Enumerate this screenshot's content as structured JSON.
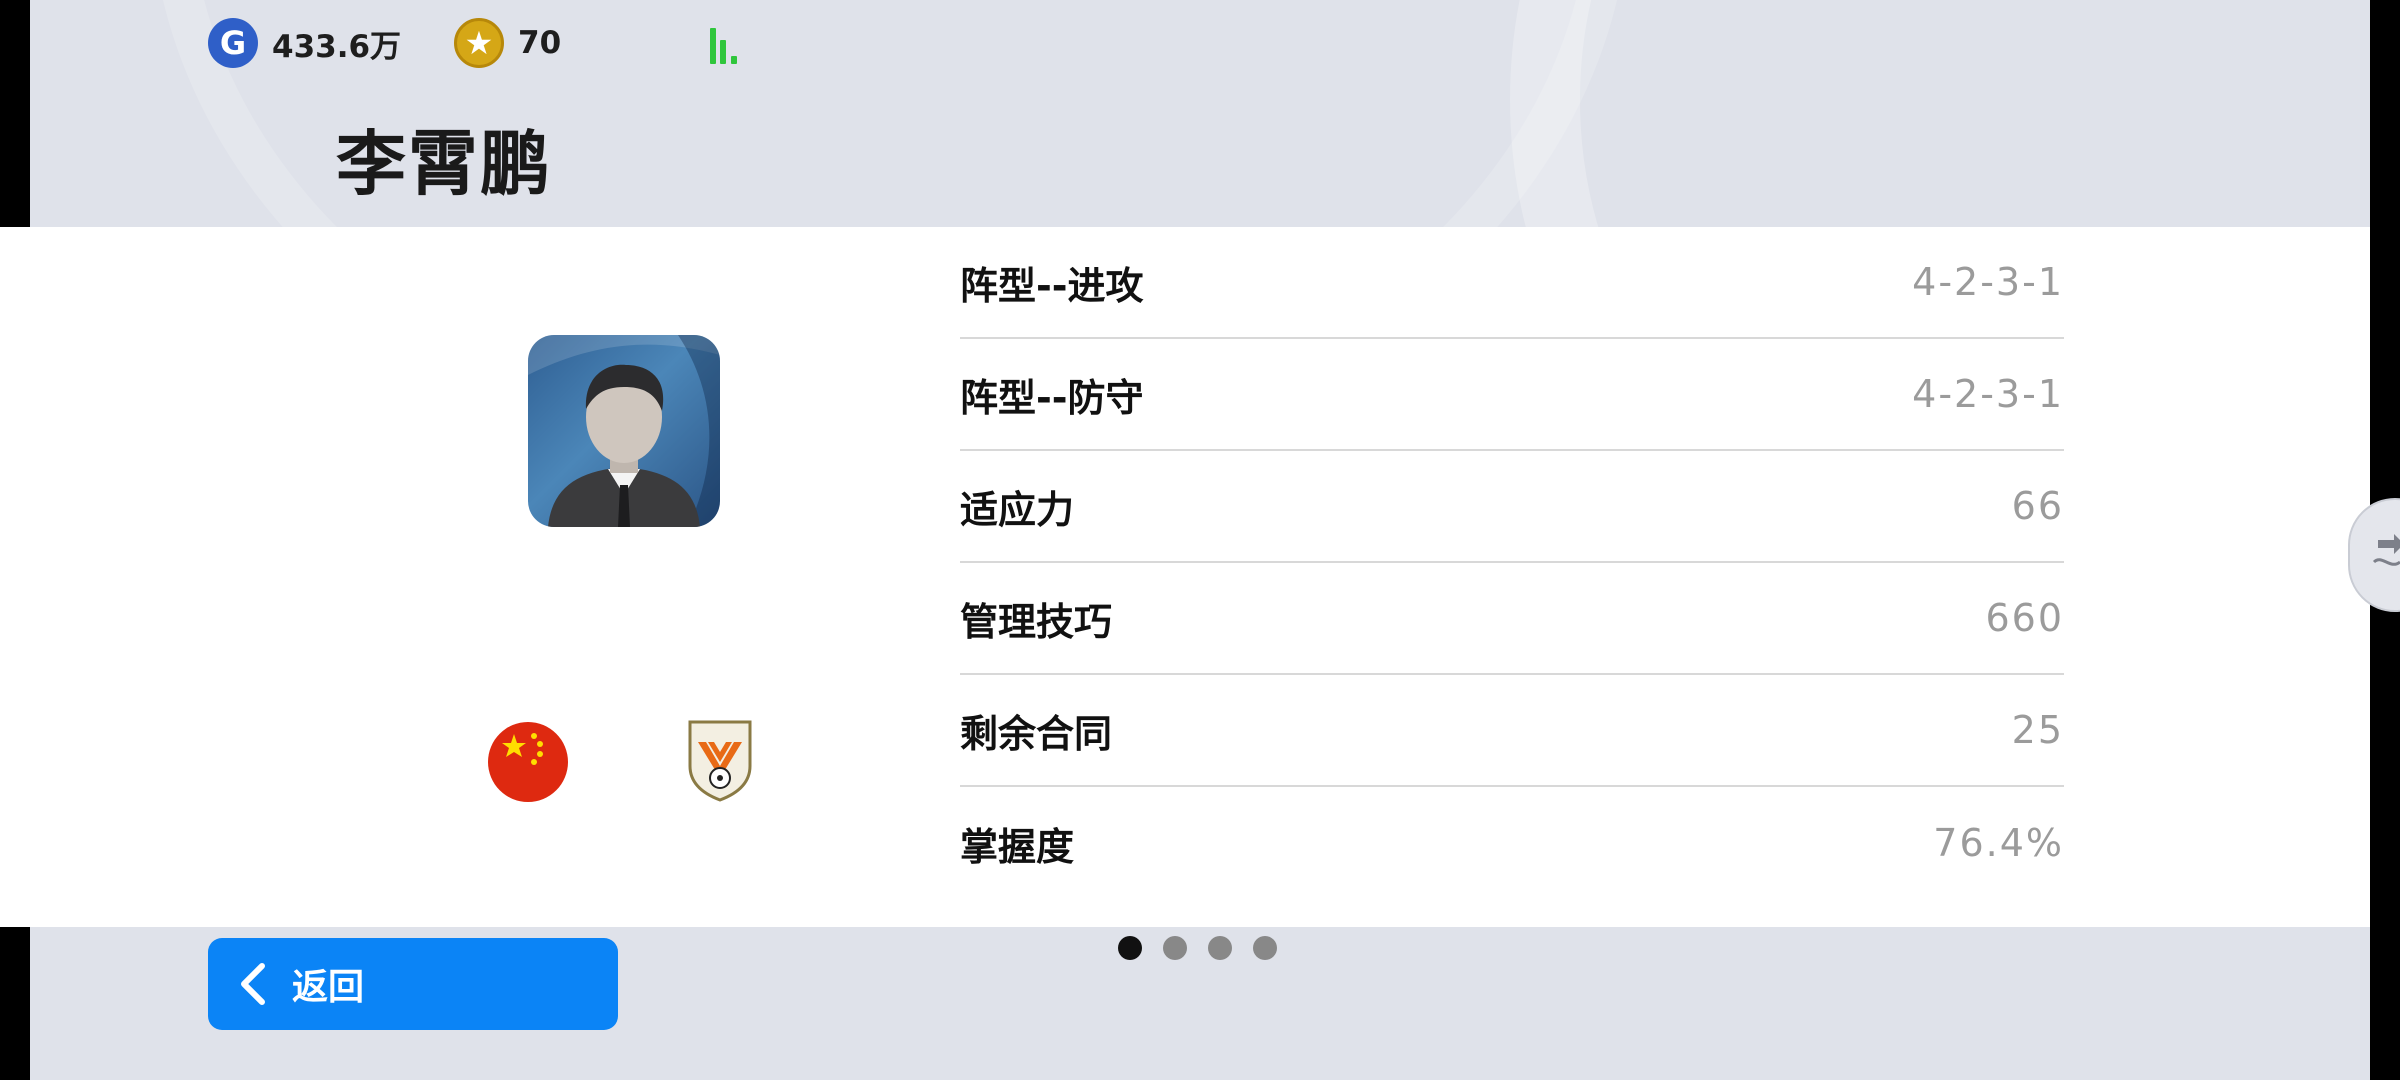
{
  "header": {
    "gp_icon": "g-coin-icon",
    "gp_value": "433.6万",
    "coin_icon": "star-coin-icon",
    "coin_value": "70",
    "signal_icon": "signal-strength-icon",
    "signal_color": "#2fc63c"
  },
  "manager": {
    "name": "李霄鹏",
    "avatar": "manager-silhouette-avatar",
    "nationality_flag": "china-flag-icon",
    "club_badge": "club-crest-icon"
  },
  "stats": [
    {
      "label": "阵型--进攻",
      "value": "4-2-3-1"
    },
    {
      "label": "阵型--防守",
      "value": "4-2-3-1"
    },
    {
      "label": "适应力",
      "value": "66"
    },
    {
      "label": "管理技巧",
      "value": "660"
    },
    {
      "label": "剩余合同",
      "value": "25"
    },
    {
      "label": "掌握度",
      "value": "76.4%"
    }
  ],
  "pagination": {
    "pages": 4,
    "current": 1
  },
  "footer": {
    "back_label": "返回",
    "back_color": "#0b84f6"
  }
}
